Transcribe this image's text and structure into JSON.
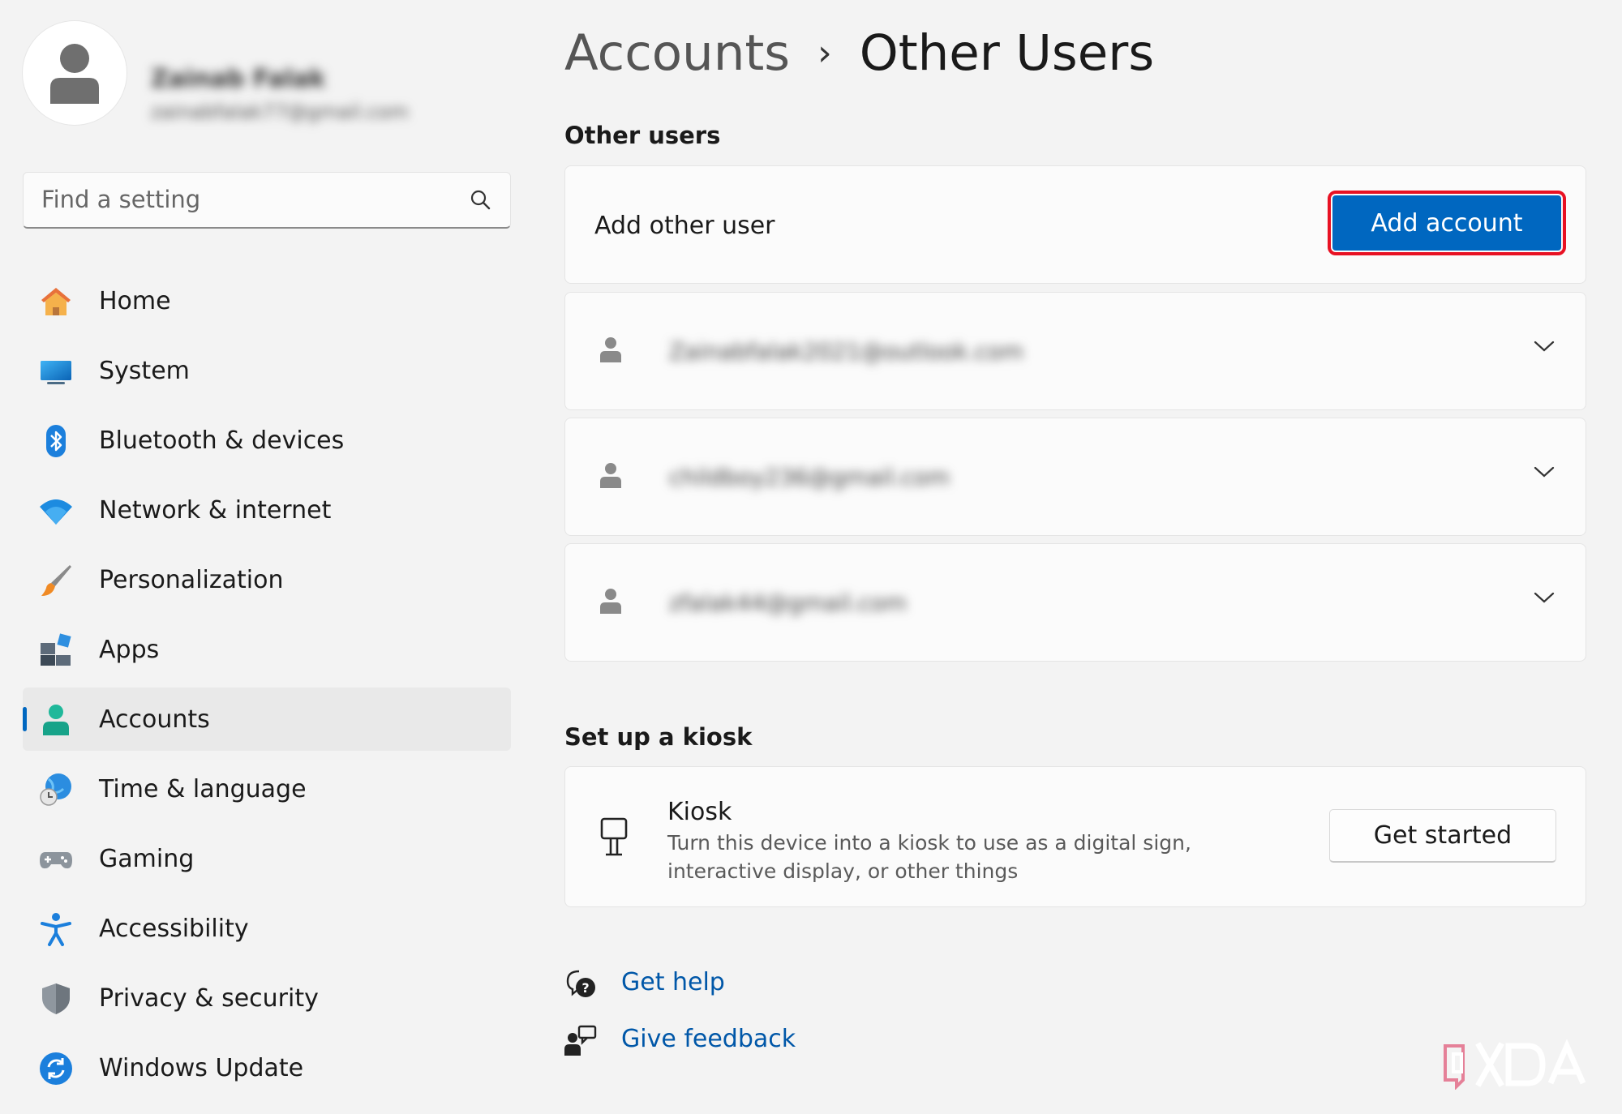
{
  "profile": {
    "name": "Zainab Falak",
    "email": "zainabfalak77@gmail.com"
  },
  "search": {
    "placeholder": "Find a setting"
  },
  "sidebar": {
    "items": [
      {
        "label": "Home",
        "icon": "home-icon"
      },
      {
        "label": "System",
        "icon": "system-icon"
      },
      {
        "label": "Bluetooth & devices",
        "icon": "bluetooth-icon"
      },
      {
        "label": "Network & internet",
        "icon": "wifi-icon"
      },
      {
        "label": "Personalization",
        "icon": "brush-icon"
      },
      {
        "label": "Apps",
        "icon": "apps-icon"
      },
      {
        "label": "Accounts",
        "icon": "accounts-icon",
        "active": true
      },
      {
        "label": "Time & language",
        "icon": "globe-clock-icon"
      },
      {
        "label": "Gaming",
        "icon": "gamepad-icon"
      },
      {
        "label": "Accessibility",
        "icon": "accessibility-icon"
      },
      {
        "label": "Privacy & security",
        "icon": "shield-icon"
      },
      {
        "label": "Windows Update",
        "icon": "update-icon"
      }
    ]
  },
  "header": {
    "parent": "Accounts",
    "separator": "›",
    "current": "Other Users"
  },
  "other_users": {
    "section_title": "Other users",
    "add_label": "Add other user",
    "add_button": "Add account",
    "users": [
      {
        "email": "Zainabfalak2021@outlook.com"
      },
      {
        "email": "childboy236@gmail.com"
      },
      {
        "email": "zfalak44@gmail.com"
      }
    ]
  },
  "kiosk": {
    "section_title": "Set up a kiosk",
    "title": "Kiosk",
    "description": "Turn this device into a kiosk to use as a digital sign, interactive display, or other things",
    "button": "Get started"
  },
  "links": {
    "help": "Get help",
    "feedback": "Give feedback"
  },
  "colors": {
    "accent": "#0067c0",
    "highlight_outline": "#e81123",
    "link": "#0057a8"
  }
}
